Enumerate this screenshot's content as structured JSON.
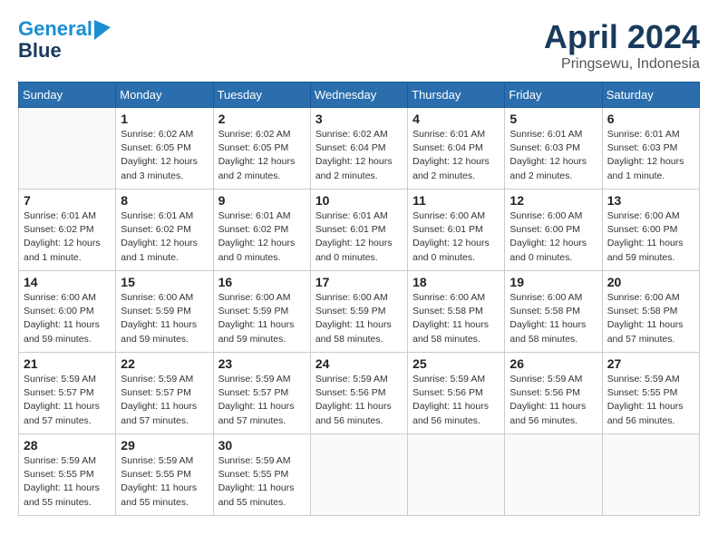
{
  "header": {
    "logo_line1": "General",
    "logo_line2": "Blue",
    "month_title": "April 2024",
    "subtitle": "Pringsewu, Indonesia"
  },
  "weekdays": [
    "Sunday",
    "Monday",
    "Tuesday",
    "Wednesday",
    "Thursday",
    "Friday",
    "Saturday"
  ],
  "weeks": [
    [
      {
        "num": "",
        "detail": ""
      },
      {
        "num": "1",
        "detail": "Sunrise: 6:02 AM\nSunset: 6:05 PM\nDaylight: 12 hours\nand 3 minutes."
      },
      {
        "num": "2",
        "detail": "Sunrise: 6:02 AM\nSunset: 6:05 PM\nDaylight: 12 hours\nand 2 minutes."
      },
      {
        "num": "3",
        "detail": "Sunrise: 6:02 AM\nSunset: 6:04 PM\nDaylight: 12 hours\nand 2 minutes."
      },
      {
        "num": "4",
        "detail": "Sunrise: 6:01 AM\nSunset: 6:04 PM\nDaylight: 12 hours\nand 2 minutes."
      },
      {
        "num": "5",
        "detail": "Sunrise: 6:01 AM\nSunset: 6:03 PM\nDaylight: 12 hours\nand 2 minutes."
      },
      {
        "num": "6",
        "detail": "Sunrise: 6:01 AM\nSunset: 6:03 PM\nDaylight: 12 hours\nand 1 minute."
      }
    ],
    [
      {
        "num": "7",
        "detail": "Sunrise: 6:01 AM\nSunset: 6:02 PM\nDaylight: 12 hours\nand 1 minute."
      },
      {
        "num": "8",
        "detail": "Sunrise: 6:01 AM\nSunset: 6:02 PM\nDaylight: 12 hours\nand 1 minute."
      },
      {
        "num": "9",
        "detail": "Sunrise: 6:01 AM\nSunset: 6:02 PM\nDaylight: 12 hours\nand 0 minutes."
      },
      {
        "num": "10",
        "detail": "Sunrise: 6:01 AM\nSunset: 6:01 PM\nDaylight: 12 hours\nand 0 minutes."
      },
      {
        "num": "11",
        "detail": "Sunrise: 6:00 AM\nSunset: 6:01 PM\nDaylight: 12 hours\nand 0 minutes."
      },
      {
        "num": "12",
        "detail": "Sunrise: 6:00 AM\nSunset: 6:00 PM\nDaylight: 12 hours\nand 0 minutes."
      },
      {
        "num": "13",
        "detail": "Sunrise: 6:00 AM\nSunset: 6:00 PM\nDaylight: 11 hours\nand 59 minutes."
      }
    ],
    [
      {
        "num": "14",
        "detail": "Sunrise: 6:00 AM\nSunset: 6:00 PM\nDaylight: 11 hours\nand 59 minutes."
      },
      {
        "num": "15",
        "detail": "Sunrise: 6:00 AM\nSunset: 5:59 PM\nDaylight: 11 hours\nand 59 minutes."
      },
      {
        "num": "16",
        "detail": "Sunrise: 6:00 AM\nSunset: 5:59 PM\nDaylight: 11 hours\nand 59 minutes."
      },
      {
        "num": "17",
        "detail": "Sunrise: 6:00 AM\nSunset: 5:59 PM\nDaylight: 11 hours\nand 58 minutes."
      },
      {
        "num": "18",
        "detail": "Sunrise: 6:00 AM\nSunset: 5:58 PM\nDaylight: 11 hours\nand 58 minutes."
      },
      {
        "num": "19",
        "detail": "Sunrise: 6:00 AM\nSunset: 5:58 PM\nDaylight: 11 hours\nand 58 minutes."
      },
      {
        "num": "20",
        "detail": "Sunrise: 6:00 AM\nSunset: 5:58 PM\nDaylight: 11 hours\nand 57 minutes."
      }
    ],
    [
      {
        "num": "21",
        "detail": "Sunrise: 5:59 AM\nSunset: 5:57 PM\nDaylight: 11 hours\nand 57 minutes."
      },
      {
        "num": "22",
        "detail": "Sunrise: 5:59 AM\nSunset: 5:57 PM\nDaylight: 11 hours\nand 57 minutes."
      },
      {
        "num": "23",
        "detail": "Sunrise: 5:59 AM\nSunset: 5:57 PM\nDaylight: 11 hours\nand 57 minutes."
      },
      {
        "num": "24",
        "detail": "Sunrise: 5:59 AM\nSunset: 5:56 PM\nDaylight: 11 hours\nand 56 minutes."
      },
      {
        "num": "25",
        "detail": "Sunrise: 5:59 AM\nSunset: 5:56 PM\nDaylight: 11 hours\nand 56 minutes."
      },
      {
        "num": "26",
        "detail": "Sunrise: 5:59 AM\nSunset: 5:56 PM\nDaylight: 11 hours\nand 56 minutes."
      },
      {
        "num": "27",
        "detail": "Sunrise: 5:59 AM\nSunset: 5:55 PM\nDaylight: 11 hours\nand 56 minutes."
      }
    ],
    [
      {
        "num": "28",
        "detail": "Sunrise: 5:59 AM\nSunset: 5:55 PM\nDaylight: 11 hours\nand 55 minutes."
      },
      {
        "num": "29",
        "detail": "Sunrise: 5:59 AM\nSunset: 5:55 PM\nDaylight: 11 hours\nand 55 minutes."
      },
      {
        "num": "30",
        "detail": "Sunrise: 5:59 AM\nSunset: 5:55 PM\nDaylight: 11 hours\nand 55 minutes."
      },
      {
        "num": "",
        "detail": ""
      },
      {
        "num": "",
        "detail": ""
      },
      {
        "num": "",
        "detail": ""
      },
      {
        "num": "",
        "detail": ""
      }
    ]
  ]
}
